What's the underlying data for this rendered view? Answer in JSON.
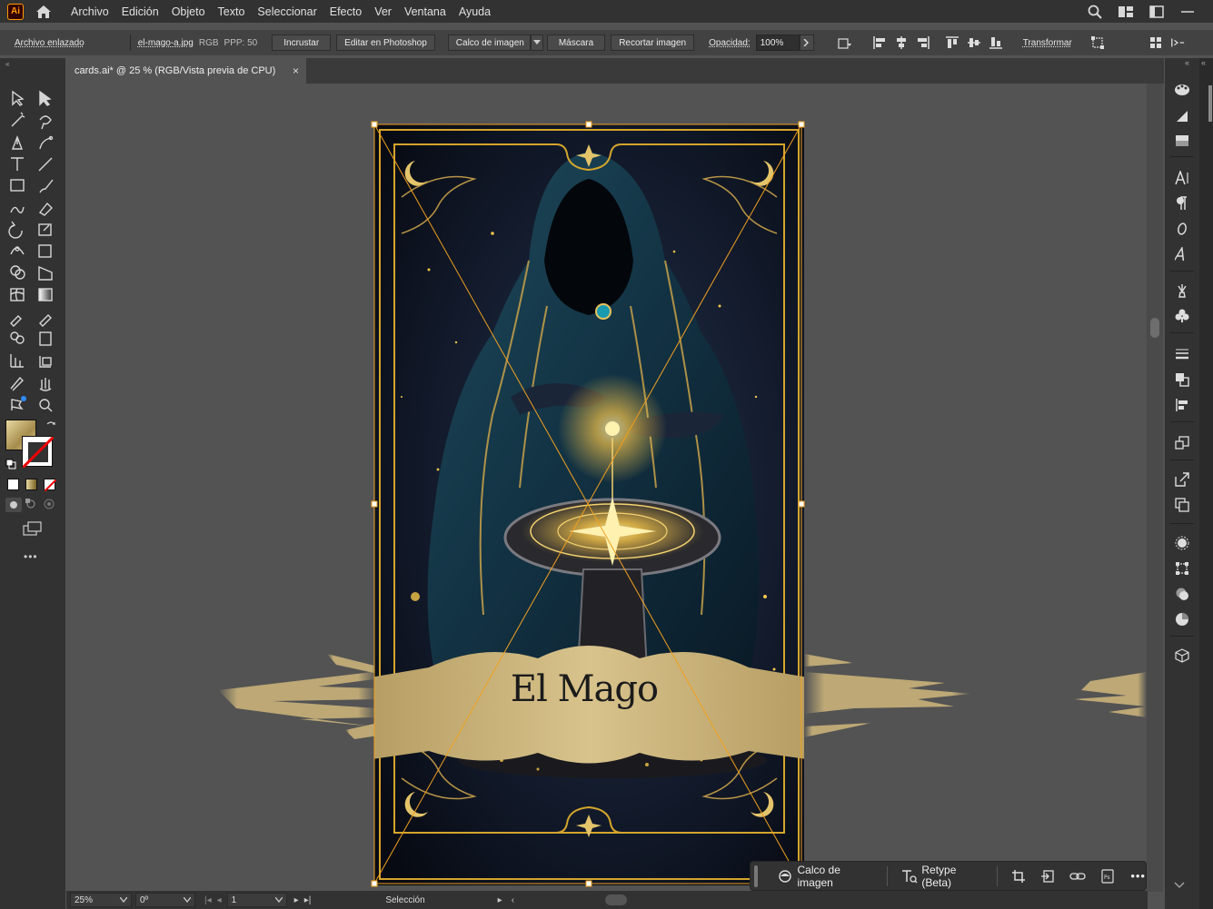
{
  "app": {
    "logo": "Ai"
  },
  "menu": [
    "Archivo",
    "Edición",
    "Objeto",
    "Texto",
    "Seleccionar",
    "Efecto",
    "Ver",
    "Ventana",
    "Ayuda"
  ],
  "control": {
    "linked_label": "Archivo enlazado",
    "filename": "el-mago-a.jpg",
    "color_mode": "RGB",
    "ppi": "PPP: 50",
    "embed": "Incrustar",
    "edit_photoshop": "Editar en Photoshop",
    "image_trace": "Calco de imagen",
    "mask": "Máscara",
    "crop": "Recortar imagen",
    "opacity_label": "Opacidad:",
    "opacity_value": "100%",
    "transform": "Transformar"
  },
  "document": {
    "tab_title": "cards.ai* @ 25 % (RGB/Vista previa de CPU)",
    "close_glyph": "×",
    "card_title": "El Mago"
  },
  "status": {
    "zoom": "25%",
    "rotation": "0º",
    "artboard": "1",
    "tool": "Selección"
  },
  "taskbar": {
    "trace": "Calco de imagen",
    "retype": "Retype (Beta)",
    "more": "•••"
  },
  "colors": {
    "accent": "#d4a52c",
    "gold_light": "#e9d39a",
    "banner": "#c7b078",
    "selection": "#f0a020"
  }
}
